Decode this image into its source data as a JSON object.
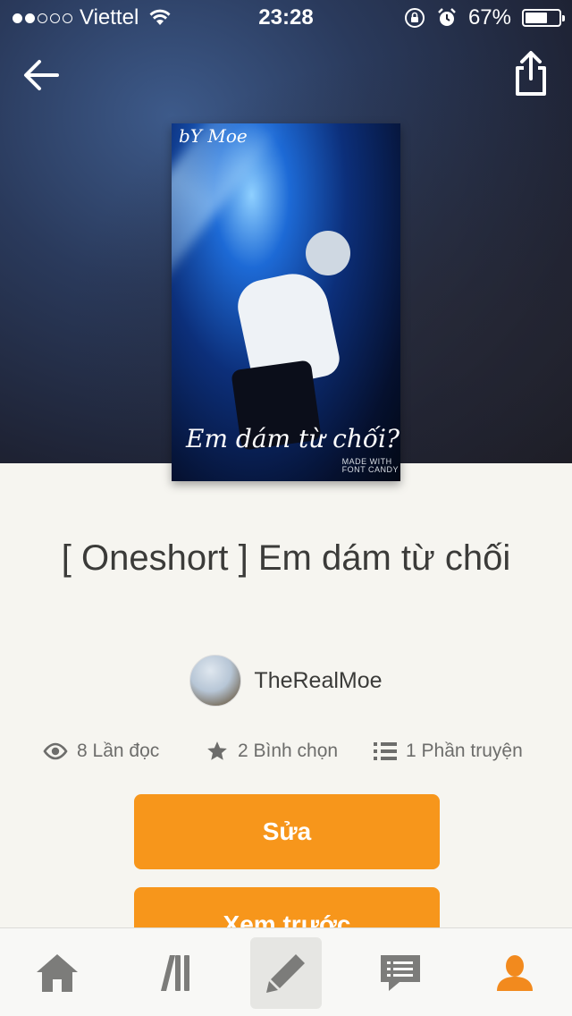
{
  "status_bar": {
    "carrier": "Viettel",
    "time": "23:28",
    "battery": "67%",
    "battery_level": 0.67,
    "signal_bars": 2
  },
  "header": {
    "back_icon": "arrow-left-icon",
    "share_icon": "share-icon"
  },
  "cover": {
    "byline": "bY Moe",
    "title": "Em dám từ chối?",
    "credit_line1": "MADE WITH",
    "credit_line2": "FONT CANDY"
  },
  "story": {
    "title": "[ Oneshort ] Em dám từ chối",
    "author": "TheRealMoe"
  },
  "stats": {
    "reads": "8 Lần đọc",
    "votes": "2 Bình chọn",
    "parts": "1 Phần truyện"
  },
  "buttons": {
    "edit": "Sửa",
    "preview": "Xem trước"
  },
  "tab_bar": {
    "items": [
      {
        "icon": "home-icon"
      },
      {
        "icon": "library-icon"
      },
      {
        "icon": "pencil-icon"
      },
      {
        "icon": "messages-icon"
      },
      {
        "icon": "profile-icon"
      }
    ]
  },
  "colors": {
    "accent": "#f7961b",
    "text": "#3b3b39",
    "muted": "#6d6d6b",
    "background": "#f6f5f0"
  }
}
